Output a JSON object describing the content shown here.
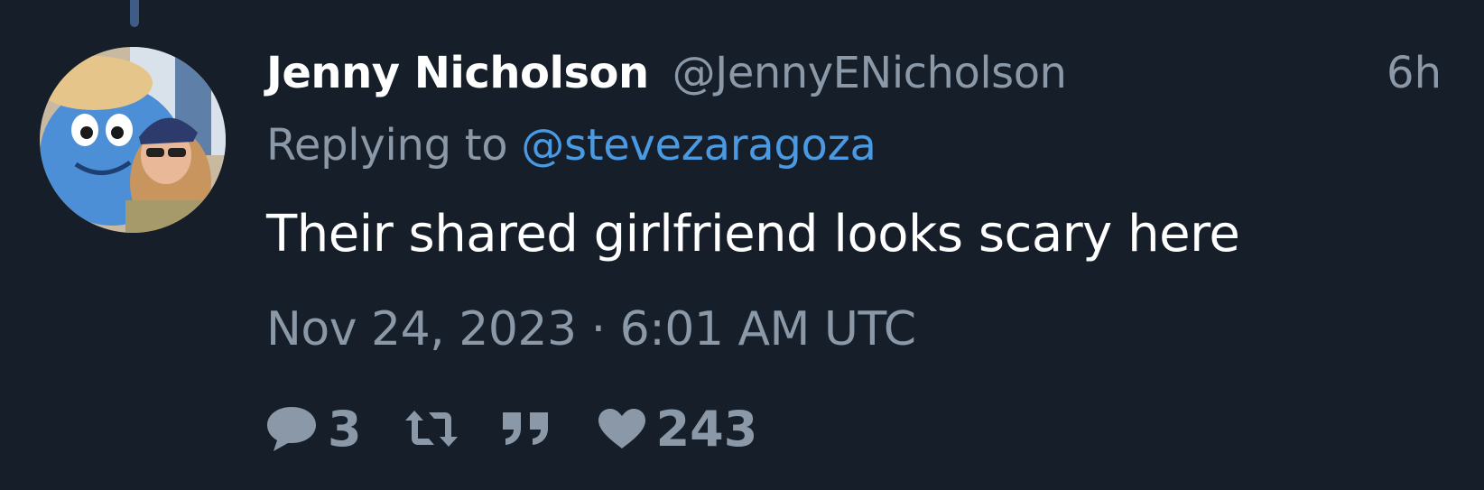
{
  "tweet": {
    "author_name": "Jenny Nicholson",
    "author_handle": "@JennyENicholson",
    "relative_time": "6h",
    "replying_prefix": "Replying to",
    "replying_to": "@stevezaragoza",
    "text": "Their shared girlfriend looks scary here",
    "timestamp": "Nov 24, 2023 · 6:01 AM UTC"
  },
  "stats": {
    "comments": "3",
    "likes": "243"
  },
  "icons": {
    "comment": "speech-bubble-icon",
    "retweet": "retweet-icon",
    "quote": "quote-icon",
    "like": "heart-icon"
  },
  "colors": {
    "background": "#161f29",
    "name": "#ffffff",
    "muted": "#8a98a8",
    "link": "#4a9ae3",
    "thread_line": "#3e5c86"
  }
}
